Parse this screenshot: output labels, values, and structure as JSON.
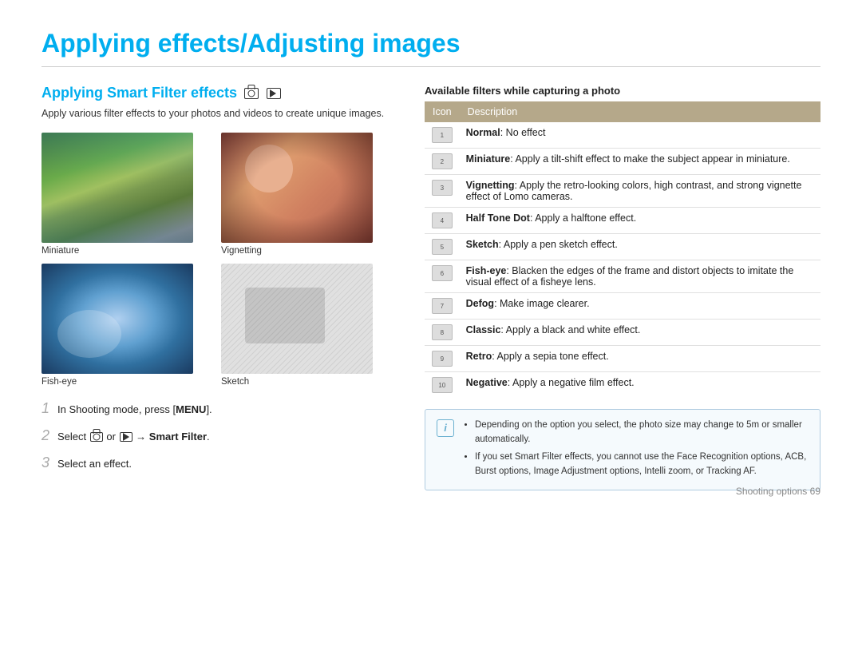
{
  "page": {
    "title": "Applying effects/Adjusting images",
    "footer": "Shooting options  69"
  },
  "section": {
    "title": "Applying Smart Filter effects",
    "description": "Apply various filter effects to your photos and videos to create unique images.",
    "images": [
      {
        "label": "Miniature",
        "type": "miniature"
      },
      {
        "label": "Vignetting",
        "type": "vignetting"
      },
      {
        "label": "Fish-eye",
        "type": "fisheye"
      },
      {
        "label": "Sketch",
        "type": "sketch"
      }
    ],
    "steps": [
      {
        "num": "1",
        "text_before": "In Shooting mode, press [",
        "bold": "MENU",
        "text_after": "]."
      },
      {
        "num": "2",
        "text_before": "Select ",
        "bold": "",
        "text_after": " or    → Smart Filter."
      },
      {
        "num": "3",
        "text_plain": "Select an effect."
      }
    ]
  },
  "right": {
    "table_title": "Available filters while capturing a photo",
    "table_headers": [
      "Icon",
      "Description"
    ],
    "filters": [
      {
        "desc_bold": "Normal",
        "desc": ": No effect"
      },
      {
        "desc_bold": "Miniature",
        "desc": ": Apply a tilt-shift effect to make the subject appear in miniature."
      },
      {
        "desc_bold": "Vignetting",
        "desc": ": Apply the retro-looking colors, high contrast, and strong vignette effect of Lomo cameras."
      },
      {
        "desc_bold": "Half Tone Dot",
        "desc": ": Apply a halftone effect."
      },
      {
        "desc_bold": "Sketch",
        "desc": ": Apply a pen sketch effect."
      },
      {
        "desc_bold": "Fish-eye",
        "desc": ": Blacken the edges of the frame and distort objects to imitate the visual effect of a fisheye lens."
      },
      {
        "desc_bold": "Defog",
        "desc": ": Make image clearer."
      },
      {
        "desc_bold": "Classic",
        "desc": ": Apply a black and white effect."
      },
      {
        "desc_bold": "Retro",
        "desc": ": Apply a sepia tone effect."
      },
      {
        "desc_bold": "Negative",
        "desc": ": Apply a negative film effect."
      }
    ],
    "note_bullets": [
      "Depending on the option you select, the photo size may change to 5m or smaller automatically.",
      "If you set Smart Filter effects, you cannot use the Face Recognition options, ACB, Burst options, Image Adjustment options, Intelli zoom, or Tracking AF."
    ]
  }
}
